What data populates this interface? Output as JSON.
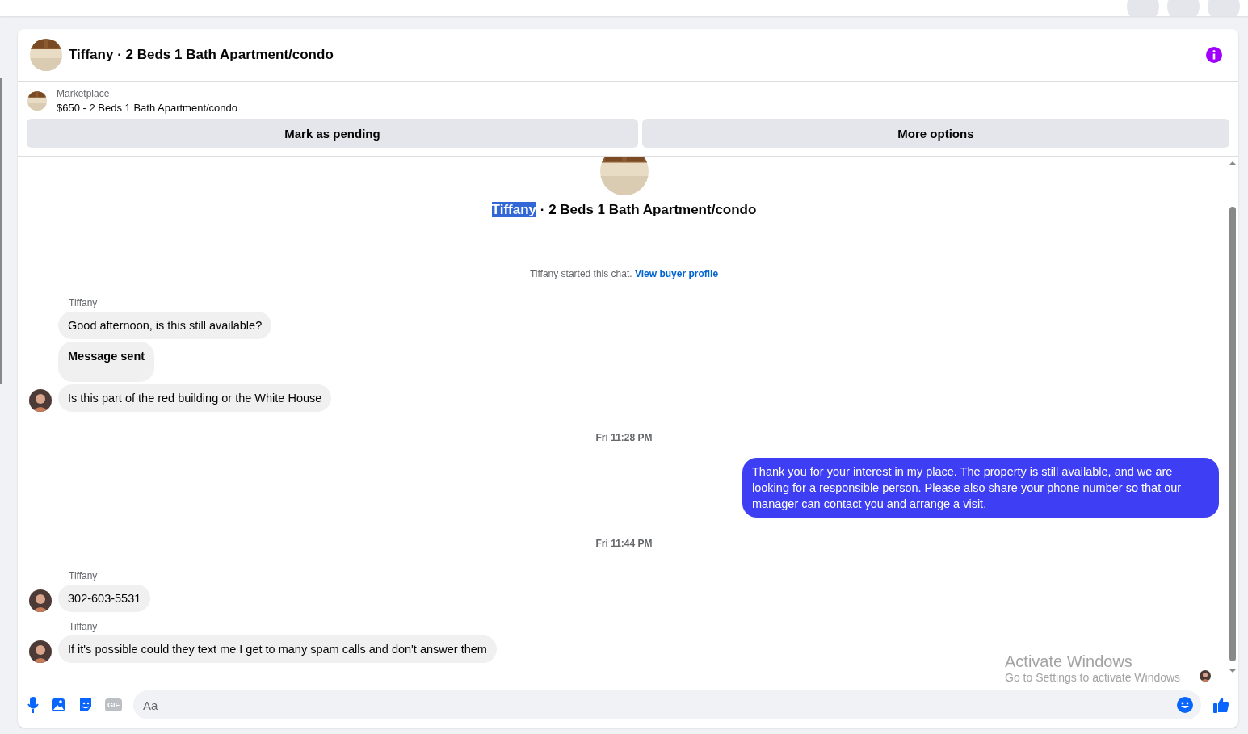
{
  "header": {
    "title": "Tiffany · 2 Beds 1 Bath Apartment/condo"
  },
  "listing": {
    "source": "Marketplace",
    "summary": "$650 - 2 Beds 1 Bath Apartment/condo"
  },
  "actions": [
    "Mark as pending",
    "More options"
  ],
  "intro": {
    "name": "Tiffany",
    "name_selected": true,
    "rest": "· 2 Beds 1 Bath Apartment/condo",
    "notice": "Tiffany started this chat.",
    "link": "View buyer profile"
  },
  "messages": [
    {
      "kind": "sender",
      "text": "Tiffany"
    },
    {
      "kind": "incoming",
      "text": "Good afternoon, is this still available?",
      "avatar": false
    },
    {
      "kind": "notice",
      "text": "Message sent",
      "avatar": false
    },
    {
      "kind": "incoming",
      "text": "Is this part of the red building or the White House",
      "avatar": true
    },
    {
      "kind": "time",
      "text": "Fri 11:28 PM"
    },
    {
      "kind": "outgoing",
      "text": "Thank you for your interest in my place. The property is still available, and we are looking for a responsible person. Please also share your phone number so that our manager can contact you and arrange a visit."
    },
    {
      "kind": "time",
      "text": "Fri 11:44 PM"
    },
    {
      "kind": "sender",
      "text": "Tiffany"
    },
    {
      "kind": "incoming",
      "text": "302-603-5531",
      "avatar": true
    },
    {
      "kind": "sender",
      "text": "Tiffany"
    },
    {
      "kind": "incoming",
      "text": "If it's possible could they text me I get to many spam calls and don't answer them",
      "avatar": true
    }
  ],
  "composer": {
    "placeholder": "Aa",
    "gif": "GIF"
  },
  "overlay": {
    "title": "Activate Windows",
    "subtitle": "Go to Settings to activate Windows"
  }
}
